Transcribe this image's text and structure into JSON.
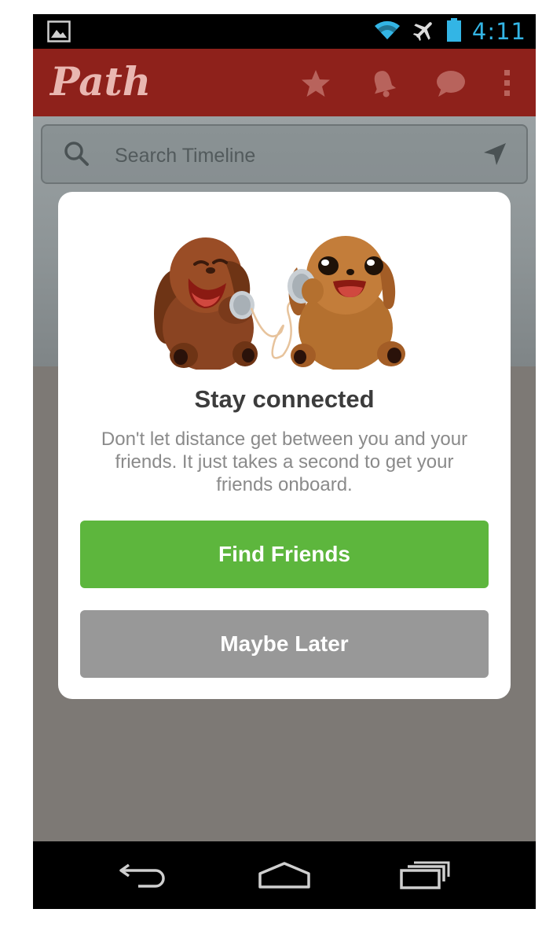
{
  "status_bar": {
    "time": "4:11",
    "icons": [
      "gallery-icon",
      "wifi-icon",
      "airplane-icon",
      "battery-icon"
    ],
    "time_color": "#33b5e5"
  },
  "action_bar": {
    "logo": "Path",
    "color": "#8e211b",
    "icons": [
      "star-icon",
      "bell-icon",
      "chat-icon",
      "overflow-menu-icon"
    ]
  },
  "search": {
    "placeholder": "Search Timeline"
  },
  "dialog": {
    "title": "Stay connected",
    "body": "Don't let distance get between you and your friends. It just takes a second to get your friends onboard.",
    "primary_button": "Find Friends",
    "secondary_button": "Maybe Later",
    "primary_color": "#5db63d",
    "secondary_color": "#989898"
  },
  "fab": {
    "symbol": "+",
    "color": "#8e2119"
  },
  "nav_bar": {
    "icons": [
      "back-icon",
      "home-icon",
      "recent-apps-icon"
    ]
  }
}
